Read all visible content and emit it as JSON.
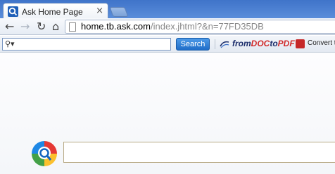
{
  "tab": {
    "title": "Ask Home Page",
    "close_glyph": "×",
    "favicon": "ask-q-icon"
  },
  "nav": {
    "back_glyph": "←",
    "forward_glyph": "→",
    "reload_glyph": "↻",
    "home_glyph": "⌂",
    "url_host": "home.tb.ask.com",
    "url_path": "/index.jhtml?&n=77FD35DB"
  },
  "toolbar": {
    "search_icon_glyph": "⚲▾",
    "search_value": "",
    "search_button_label": "Search",
    "brand_part1": "from",
    "brand_part2": "DOC",
    "brand_part3": "to",
    "brand_part4": "PDF",
    "convert_label": "Convert to"
  },
  "page": {
    "search_value": ""
  },
  "colors": {
    "accent_blue": "#1f6dc8",
    "brand_navy": "#1c2e6b",
    "brand_red": "#d12a2a"
  }
}
